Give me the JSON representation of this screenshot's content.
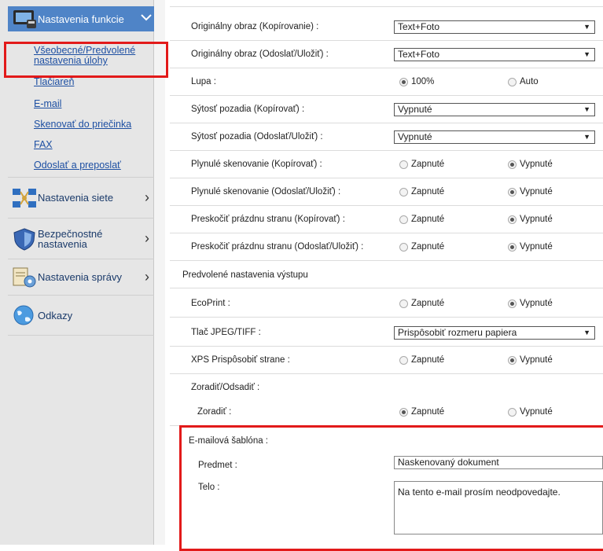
{
  "sidebar": {
    "active_header": "Nastavenia funkcie",
    "sub_links": [
      "Všeobecné/Predvolené",
      "nastavenia úlohy",
      "Tlačiareň",
      "E-mail",
      "Skenovať do priečinka",
      "FAX",
      "Odoslať a preposlať"
    ],
    "sections": {
      "network": "Nastavenia siete",
      "security_line1": "Bezpečnostné",
      "security_line2": "nastavenia",
      "admin": "Nastavenia správy",
      "links": "Odkazy"
    }
  },
  "form": {
    "rows": [
      {
        "label": "Originálny obraz (Kopírovanie) :",
        "value": "Text+Foto"
      },
      {
        "label": "Originálny obraz (Odoslať/Uložiť) :",
        "value": "Text+Foto"
      },
      {
        "label": "Lupa :",
        "opt1": "100%",
        "opt2": "Auto"
      },
      {
        "label": "Sýtosť pozadia (Kopírovať) :",
        "value": "Vypnuté"
      },
      {
        "label": "Sýtosť pozadia (Odoslať/Uložiť) :",
        "value": "Vypnuté"
      },
      {
        "label": "Plynulé skenovanie (Kopírovať) :",
        "opt1": "Zapnuté",
        "opt2": "Vypnuté"
      },
      {
        "label": "Plynulé skenovanie (Odoslať/Uložiť) :",
        "opt1": "Zapnuté",
        "opt2": "Vypnuté"
      },
      {
        "label": "Preskočiť prázdnu stranu (Kopírovať) :",
        "opt1": "Zapnuté",
        "opt2": "Vypnuté"
      },
      {
        "label": "Preskočiť prázdnu stranu (Odoslať/Uložiť) :",
        "opt1": "Zapnuté",
        "opt2": "Vypnuté"
      }
    ],
    "output_section": "Predvolené nastavenia výstupu",
    "output_rows": [
      {
        "label": "EcoPrint :",
        "opt1": "Zapnuté",
        "opt2": "Vypnuté"
      },
      {
        "label": "Tlač JPEG/TIFF :",
        "value": "Prispôsobiť rozmeru papiera"
      },
      {
        "label": "XPS Prispôsobiť strane :",
        "opt1": "Zapnuté",
        "opt2": "Vypnuté"
      },
      {
        "label": "Zoradiť/Odsadiť :"
      },
      {
        "label": "Zoradiť :",
        "opt1": "Zapnuté",
        "opt2": "Vypnuté"
      }
    ],
    "email_template": {
      "title": "E-mailová šablóna :",
      "subject_label": "Predmet :",
      "subject_value": "Naskenovaný dokument",
      "body_label": "Telo :",
      "body_value": "Na tento e-mail prosím neodpovedajte."
    }
  },
  "colors": {
    "accent": "#4f84c7",
    "highlight": "#e21a1a",
    "link": "#1d4fa2"
  }
}
